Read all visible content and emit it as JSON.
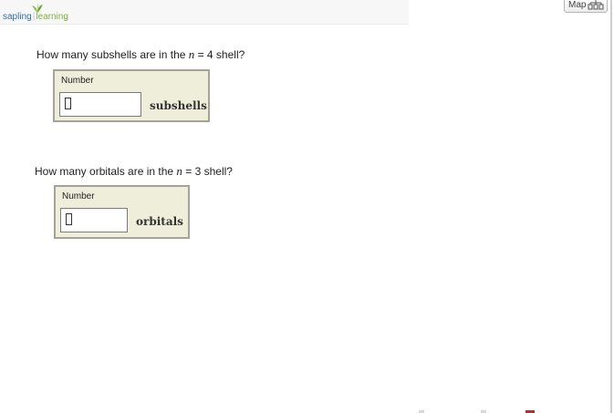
{
  "header": {
    "logo": {
      "brand_left": "sapling",
      "separator": "|",
      "brand_right": "learning",
      "colors": {
        "sapling": "#2f6ea3",
        "learning": "#7fb23f"
      }
    },
    "map_button": {
      "label": "Map",
      "icon": "map-icon"
    }
  },
  "questions": [
    {
      "prefix": "How many subshells are in the ",
      "variable": "n",
      "suffix": " = 4 shell?",
      "field_label": "Number",
      "value": "",
      "unit": "subshells"
    },
    {
      "prefix": "How many orbitals are in the ",
      "variable": "n",
      "suffix": " = 3 shell?",
      "field_label": "Number",
      "value": "",
      "unit": "orbitals"
    }
  ],
  "colors": {
    "answer_box_bg": "#eeeeda",
    "answer_box_border": "#a3a39a"
  }
}
